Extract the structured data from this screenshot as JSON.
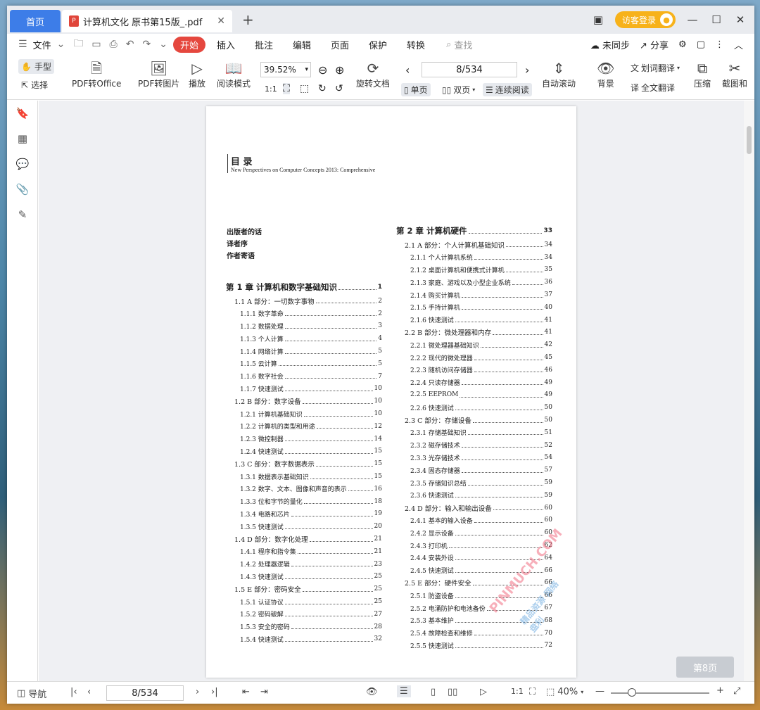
{
  "window": {
    "home_tab": "首页",
    "doc_tab": "计算机文化 原书第15版_.pdf",
    "login": "访客登录"
  },
  "menu": {
    "file": "文件",
    "start": "开始",
    "insert": "插入",
    "annotate": "批注",
    "edit": "编辑",
    "page": "页面",
    "protect": "保护",
    "convert": "转换",
    "search": "查找",
    "unsync": "未同步",
    "share": "分享"
  },
  "toolbar": {
    "hand": "手型",
    "select": "选择",
    "pdf_to_office": "PDF转Office",
    "pdf_to_image": "PDF转图片",
    "play": "播放",
    "read_mode": "阅读模式",
    "zoom": "39.52%",
    "rotate": "旋转文档",
    "page_input": "8/534",
    "single": "单页",
    "double": "双页",
    "continuous": "连续阅读",
    "auto_scroll": "自动滚动",
    "background": "背景",
    "word_translate": "划词翻译",
    "full_translate": "全文翻译",
    "compress": "压缩",
    "screenshot": "截图和"
  },
  "doc": {
    "toc_title": "目  录",
    "toc_subtitle": "New Perspectives on Computer Concepts 2013: Comprehensive",
    "front": [
      "出版者的话",
      "译者序",
      "作者寄语"
    ],
    "left": [
      {
        "n": "第 1 章",
        "t": "计算机和数字基础知识",
        "p": "1",
        "lvl": 0
      },
      {
        "n": "1.1",
        "t": "A 部分：一切数字事物",
        "p": "2",
        "lvl": 1
      },
      {
        "n": "1.1.1",
        "t": "数字革命",
        "p": "2",
        "lvl": 2
      },
      {
        "n": "1.1.2",
        "t": "数据处理",
        "p": "3",
        "lvl": 2
      },
      {
        "n": "1.1.3",
        "t": "个人计算",
        "p": "4",
        "lvl": 2
      },
      {
        "n": "1.1.4",
        "t": "网络计算",
        "p": "5",
        "lvl": 2
      },
      {
        "n": "1.1.5",
        "t": "云计算",
        "p": "5",
        "lvl": 2
      },
      {
        "n": "1.1.6",
        "t": "数字社会",
        "p": "7",
        "lvl": 2
      },
      {
        "n": "1.1.7",
        "t": "快速测试",
        "p": "10",
        "lvl": 2
      },
      {
        "n": "1.2",
        "t": "B 部分：数字设备",
        "p": "10",
        "lvl": 1
      },
      {
        "n": "1.2.1",
        "t": "计算机基础知识",
        "p": "10",
        "lvl": 2
      },
      {
        "n": "1.2.2",
        "t": "计算机的类型和用途",
        "p": "12",
        "lvl": 2
      },
      {
        "n": "1.2.3",
        "t": "微控制器",
        "p": "14",
        "lvl": 2
      },
      {
        "n": "1.2.4",
        "t": "快速测试",
        "p": "15",
        "lvl": 2
      },
      {
        "n": "1.3",
        "t": "C 部分：数字数据表示",
        "p": "15",
        "lvl": 1
      },
      {
        "n": "1.3.1",
        "t": "数据表示基础知识",
        "p": "15",
        "lvl": 2
      },
      {
        "n": "1.3.2",
        "t": "数字、文本、图像和声音的表示",
        "p": "16",
        "lvl": 2
      },
      {
        "n": "1.3.3",
        "t": "位和字节的量化",
        "p": "18",
        "lvl": 2
      },
      {
        "n": "1.3.4",
        "t": "电路和芯片",
        "p": "19",
        "lvl": 2
      },
      {
        "n": "1.3.5",
        "t": "快速测试",
        "p": "20",
        "lvl": 2
      },
      {
        "n": "1.4",
        "t": "D 部分：数字化处理",
        "p": "21",
        "lvl": 1
      },
      {
        "n": "1.4.1",
        "t": "程序和指令集",
        "p": "21",
        "lvl": 2
      },
      {
        "n": "1.4.2",
        "t": "处理器逻辑",
        "p": "23",
        "lvl": 2
      },
      {
        "n": "1.4.3",
        "t": "快速测试",
        "p": "25",
        "lvl": 2
      },
      {
        "n": "1.5",
        "t": "E 部分：密码安全",
        "p": "25",
        "lvl": 1
      },
      {
        "n": "1.5.1",
        "t": "认证协议",
        "p": "25",
        "lvl": 2
      },
      {
        "n": "1.5.2",
        "t": "密码破解",
        "p": "27",
        "lvl": 2
      },
      {
        "n": "1.5.3",
        "t": "安全的密码",
        "p": "28",
        "lvl": 2
      },
      {
        "n": "1.5.4",
        "t": "快速测试",
        "p": "32",
        "lvl": 2
      }
    ],
    "right": [
      {
        "n": "第 2 章",
        "t": "计算机硬件",
        "p": "33",
        "lvl": 0
      },
      {
        "n": "2.1",
        "t": "A 部分：个人计算机基础知识",
        "p": "34",
        "lvl": 1
      },
      {
        "n": "2.1.1",
        "t": "个人计算机系统",
        "p": "34",
        "lvl": 2
      },
      {
        "n": "2.1.2",
        "t": "桌面计算机和便携式计算机",
        "p": "35",
        "lvl": 2
      },
      {
        "n": "2.1.3",
        "t": "家庭、游戏以及小型企业系统",
        "p": "36",
        "lvl": 2
      },
      {
        "n": "2.1.4",
        "t": "购买计算机",
        "p": "37",
        "lvl": 2
      },
      {
        "n": "2.1.5",
        "t": "手持计算机",
        "p": "40",
        "lvl": 2
      },
      {
        "n": "2.1.6",
        "t": "快速测试",
        "p": "41",
        "lvl": 2
      },
      {
        "n": "2.2",
        "t": "B 部分：微处理器和内存",
        "p": "41",
        "lvl": 1
      },
      {
        "n": "2.2.1",
        "t": "微处理器基础知识",
        "p": "42",
        "lvl": 2
      },
      {
        "n": "2.2.2",
        "t": "现代的微处理器",
        "p": "45",
        "lvl": 2
      },
      {
        "n": "2.2.3",
        "t": "随机访问存储器",
        "p": "46",
        "lvl": 2
      },
      {
        "n": "2.2.4",
        "t": "只读存储器",
        "p": "49",
        "lvl": 2
      },
      {
        "n": "2.2.5",
        "t": "EEPROM",
        "p": "49",
        "lvl": 2
      },
      {
        "n": "2.2.6",
        "t": "快速测试",
        "p": "50",
        "lvl": 2
      },
      {
        "n": "2.3",
        "t": "C 部分：存储设备",
        "p": "50",
        "lvl": 1
      },
      {
        "n": "2.3.1",
        "t": "存储基础知识",
        "p": "51",
        "lvl": 2
      },
      {
        "n": "2.3.2",
        "t": "磁存储技术",
        "p": "52",
        "lvl": 2
      },
      {
        "n": "2.3.3",
        "t": "光存储技术",
        "p": "54",
        "lvl": 2
      },
      {
        "n": "2.3.4",
        "t": "固态存储器",
        "p": "57",
        "lvl": 2
      },
      {
        "n": "2.3.5",
        "t": "存储知识总结",
        "p": "59",
        "lvl": 2
      },
      {
        "n": "2.3.6",
        "t": "快速测试",
        "p": "59",
        "lvl": 2
      },
      {
        "n": "2.4",
        "t": "D 部分：输入和输出设备",
        "p": "60",
        "lvl": 1
      },
      {
        "n": "2.4.1",
        "t": "基本的输入设备",
        "p": "60",
        "lvl": 2
      },
      {
        "n": "2.4.2",
        "t": "显示设备",
        "p": "60",
        "lvl": 2
      },
      {
        "n": "2.4.3",
        "t": "打印机",
        "p": "62",
        "lvl": 2
      },
      {
        "n": "2.4.4",
        "t": "安装外设",
        "p": "64",
        "lvl": 2
      },
      {
        "n": "2.4.5",
        "t": "快速测试",
        "p": "66",
        "lvl": 2
      },
      {
        "n": "2.5",
        "t": "E 部分：硬件安全",
        "p": "66",
        "lvl": 1
      },
      {
        "n": "2.5.1",
        "t": "防盗设备",
        "p": "66",
        "lvl": 2
      },
      {
        "n": "2.5.2",
        "t": "电涌防护和电池备份",
        "p": "67",
        "lvl": 2
      },
      {
        "n": "2.5.3",
        "t": "基本维护",
        "p": "68",
        "lvl": 2
      },
      {
        "n": "2.5.4",
        "t": "故障检查和维修",
        "p": "70",
        "lvl": 2
      },
      {
        "n": "2.5.5",
        "t": "快速测试",
        "p": "72",
        "lvl": 2
      }
    ],
    "watermark": "PINMUCH.COM",
    "watermark2": "精品资源 网络盘利"
  },
  "page_indicator": "第8页",
  "status": {
    "nav": "导航",
    "page_input": "8/534",
    "zoom": "40%"
  }
}
